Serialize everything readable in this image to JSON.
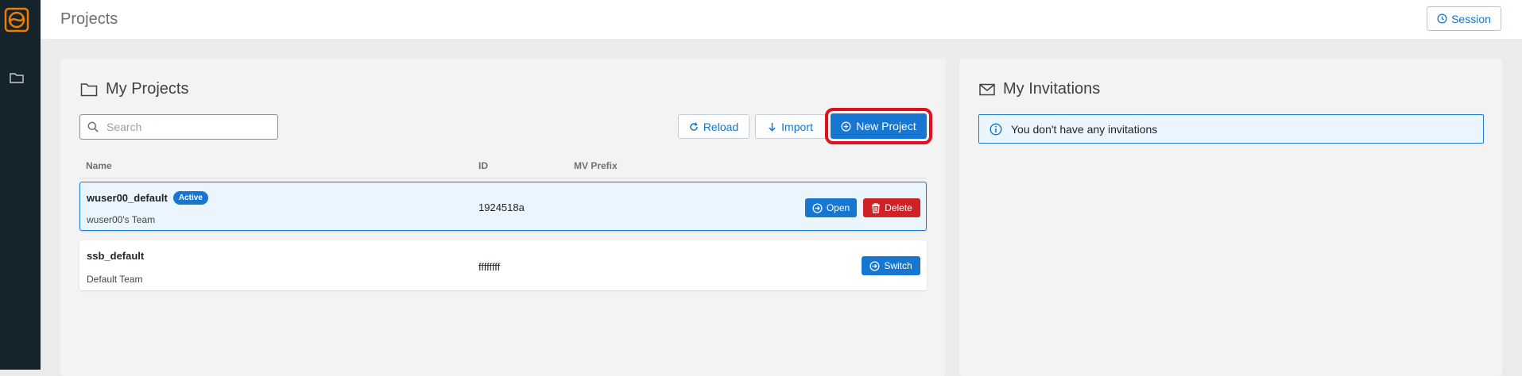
{
  "app": {
    "page_title": "Projects",
    "session_label": "Session"
  },
  "sidebar": {
    "items": [
      {
        "icon": "folder-icon"
      }
    ]
  },
  "projects_card": {
    "title": "My Projects",
    "search_placeholder": "Search",
    "search_value": "",
    "reload_label": "Reload",
    "import_label": "Import",
    "new_project_label": "New Project",
    "columns": [
      "Name",
      "ID",
      "MV Prefix"
    ],
    "rows": [
      {
        "name": "wuser00_default",
        "badge": "Active",
        "team": "wuser00's Team",
        "id": "1924518a",
        "mv_prefix": "",
        "actions": [
          "Open",
          "Delete"
        ]
      },
      {
        "name": "ssb_default",
        "badge": "",
        "team": "Default Team",
        "id": "ffffffff",
        "mv_prefix": "",
        "actions": [
          "Switch"
        ]
      }
    ]
  },
  "invitations_card": {
    "title": "My Invitations",
    "empty_message": "You don't have any invitations"
  },
  "colors": {
    "sidebar_bg": "#15232a",
    "brand_orange": "#f07d00",
    "primary_blue": "#1676d2",
    "danger_red": "#d02127",
    "highlight_red": "#e0101c"
  }
}
